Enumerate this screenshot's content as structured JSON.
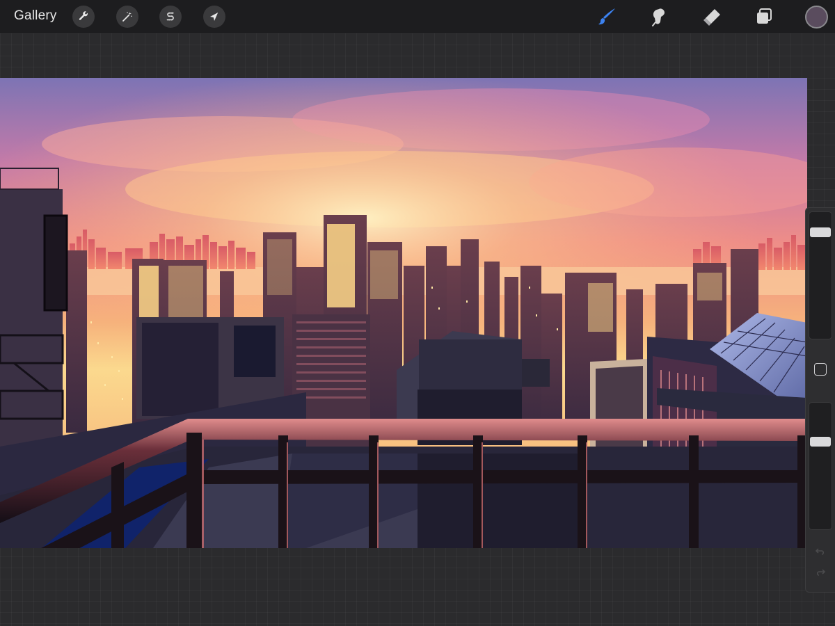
{
  "toolbar": {
    "gallery_label": "Gallery",
    "left_tools": [
      {
        "name": "wrench-icon",
        "purpose": "actions"
      },
      {
        "name": "magic-wand-icon",
        "purpose": "adjustments"
      },
      {
        "name": "selection-s-icon",
        "purpose": "selection"
      },
      {
        "name": "arrow-cursor-icon",
        "purpose": "transform"
      }
    ],
    "right_tools": [
      {
        "name": "brush-icon",
        "purpose": "paint",
        "active": true
      },
      {
        "name": "smudge-icon",
        "purpose": "smudge",
        "active": false
      },
      {
        "name": "eraser-icon",
        "purpose": "erase",
        "active": false
      },
      {
        "name": "layers-icon",
        "purpose": "layers",
        "active": false
      }
    ],
    "current_color": "#5a4c5e"
  },
  "sidebar": {
    "brush_size_level": 0.87,
    "opacity_level": 0.71
  },
  "colors": {
    "accent_active": "#3c82f0",
    "toolbar_bg": "#1d1d1f",
    "workspace_bg": "#2b2b2d"
  }
}
